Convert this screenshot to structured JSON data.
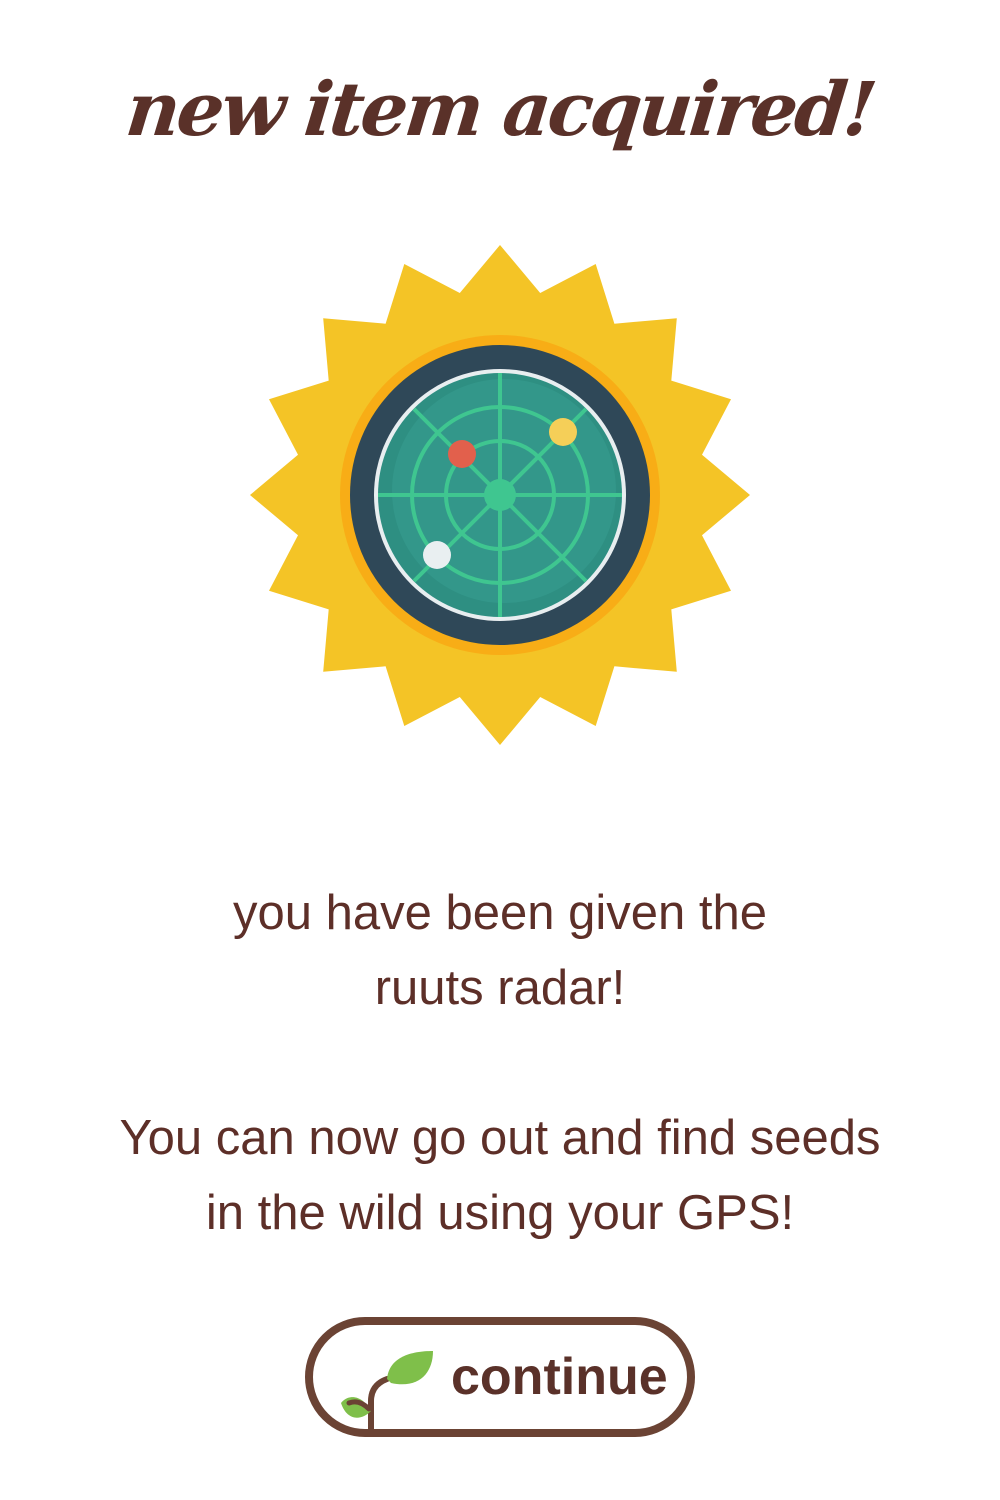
{
  "title": "new item acquired!",
  "item_icon": "radar-badge-icon",
  "message": {
    "line1": "you have been given the",
    "line2": "ruuts radar!",
    "line3": "You can now go out and find seeds",
    "line4": "in the wild using your GPS!"
  },
  "continue_button": {
    "label": "continue",
    "icon": "sprout-icon"
  },
  "colors": {
    "text": "#5d2f28",
    "badge_yellow": "#f4c426",
    "radar_ring": "#2f4858",
    "radar_screen": "#33978a",
    "radar_lines": "#3fc690",
    "button_border": "#6b4334",
    "leaf_green": "#7fbf4a"
  }
}
